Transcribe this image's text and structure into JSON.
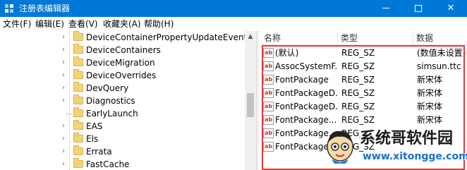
{
  "window": {
    "title": "注册表编辑器",
    "min_icon": "minimize-icon",
    "max_icon": "maximize-icon",
    "close_label": "✕"
  },
  "menu": [
    {
      "label": "文件(F)"
    },
    {
      "label": "编辑(E)"
    },
    {
      "label": "查看(V)"
    },
    {
      "label": "收藏夹(A)"
    },
    {
      "label": "帮助(H)"
    }
  ],
  "tree": {
    "items": [
      {
        "label": "DeviceContainerPropertyUpdateEvents",
        "expandable": true
      },
      {
        "label": "DeviceContainers",
        "expandable": true
      },
      {
        "label": "DeviceMigration",
        "expandable": true
      },
      {
        "label": "DeviceOverrides",
        "expandable": true
      },
      {
        "label": "DevQuery",
        "expandable": true
      },
      {
        "label": "Diagnostics",
        "expandable": true
      },
      {
        "label": "EarlyLaunch",
        "expandable": false
      },
      {
        "label": "EAS",
        "expandable": true
      },
      {
        "label": "Els",
        "expandable": true
      },
      {
        "label": "Errata",
        "expandable": true
      },
      {
        "label": "FastCache",
        "expandable": true
      }
    ]
  },
  "list": {
    "columns": {
      "name": "名称",
      "type": "类型",
      "data": "数据"
    },
    "rows": [
      {
        "name": "(默认)",
        "type": "REG_SZ",
        "data": "(数值未设置)"
      },
      {
        "name": "AssocSystemF...",
        "type": "REG_SZ",
        "data": "simsun.ttc"
      },
      {
        "name": "FontPackage",
        "type": "REG_SZ",
        "data": "新宋体"
      },
      {
        "name": "FontPackageD...",
        "type": "REG_SZ",
        "data": "新宋体"
      },
      {
        "name": "FontPackageD...",
        "type": "REG_SZ",
        "data": "新宋体"
      },
      {
        "name": "FontPackage...",
        "type": "REG_SZ",
        "data": "新宋体"
      },
      {
        "name": "FontPackage...",
        "type": "REG_SZ",
        "data": ""
      },
      {
        "name": "FontPackage...",
        "type": "REG_SZ",
        "data": ""
      }
    ]
  },
  "watermark": {
    "text": "系统哥软件园",
    "url": "www.xitongge.com"
  },
  "colors": {
    "titlebar": "#0078d7",
    "highlight": "#e03b3b",
    "folder": "#f4d27a"
  }
}
